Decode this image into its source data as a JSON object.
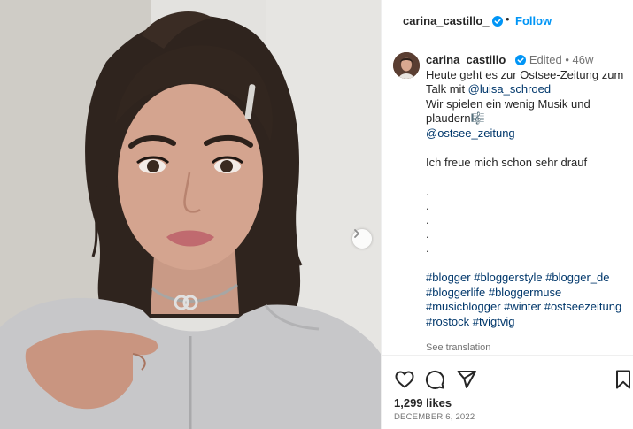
{
  "post": {
    "username": "carina_castillo_",
    "follow_label": "Follow",
    "separator": "•"
  },
  "caption": {
    "username": "carina_castillo_",
    "edited": "Edited",
    "age": "46w",
    "line1": "Heute geht es zur Ostsee-Zeitung zum",
    "line2_prefix": "Talk mit ",
    "mention1": "@luisa_schroed",
    "line3": "Wir spielen ein wenig Musik und",
    "line4": "plaudern",
    "emoji": "🎼",
    "mention2": "@ostsee_zeitung",
    "line5": "Ich freue mich schon sehr drauf",
    "dots": [
      ".",
      ".",
      ".",
      ".",
      "."
    ],
    "hashtags": {
      "row1": [
        "#blogger",
        "#bloggerstyle",
        "#blogger_de"
      ],
      "row2": [
        "#bloggerlife",
        "#bloggermuse"
      ],
      "row3": [
        "#musicblogger",
        "#winter",
        "#ostseezeitung"
      ],
      "row4": [
        "#rostock",
        "#tvigtvig"
      ]
    },
    "see_translation": "See translation"
  },
  "footer": {
    "likes": "1,299 likes",
    "date": "DECEMBER 6, 2022"
  },
  "icons": {
    "verified": "verified-badge-icon",
    "next": "chevron-right-icon",
    "like": "heart-icon",
    "comment": "comment-bubble-icon",
    "share": "paper-plane-icon",
    "save": "bookmark-icon"
  },
  "colors": {
    "link": "#00376b",
    "follow": "#0095f6",
    "verified": "#0095f6",
    "muted": "#737373",
    "text": "#262626"
  }
}
